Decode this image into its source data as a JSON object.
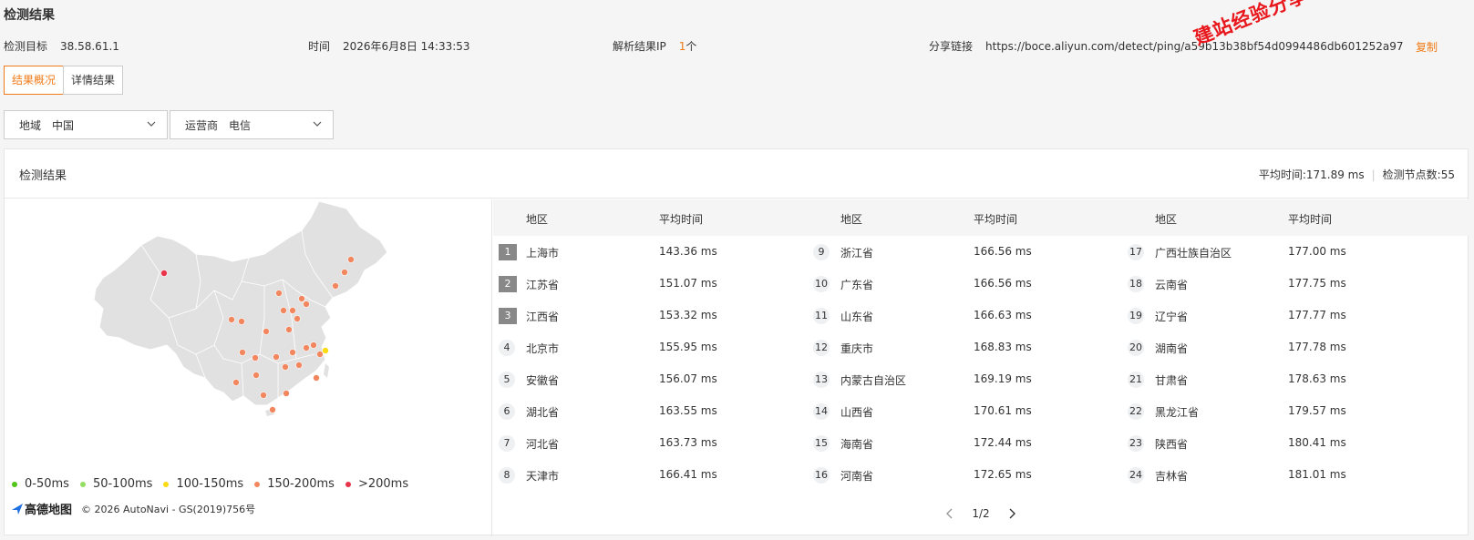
{
  "page_title": "检测结果",
  "meta": {
    "target_label": "检测目标",
    "target_value": "38.58.61.1",
    "time_label": "时间",
    "time_value": "2026年6月8日 14:33:53",
    "ip_label": "解析结果IP",
    "ip_count": "1",
    "ip_unit": "个",
    "share_label": "分享链接",
    "share_url": "https://boce.aliyun.com/detect/ping/a59b13b38bf54d0994486db601252a97",
    "copy_label": "复制"
  },
  "watermark": "建站经验分享-www.w",
  "tabs": [
    {
      "label": "结果概况",
      "active": true
    },
    {
      "label": "详情结果",
      "active": false
    }
  ],
  "filters": {
    "region_label": "地域",
    "region_value": "中国",
    "isp_label": "运营商",
    "isp_value": "电信"
  },
  "panel": {
    "title": "检测结果",
    "avg_label": "平均时间:171.89 ms",
    "nodes_label": "检测节点数:55"
  },
  "legend": [
    {
      "label": "0-50ms",
      "color": "#52c41a"
    },
    {
      "label": "50-100ms",
      "color": "#95de64"
    },
    {
      "label": "100-150ms",
      "color": "#fadb14"
    },
    {
      "label": "150-200ms",
      "color": "#f2865e"
    },
    {
      "label": ">200ms",
      "color": "#e8334a"
    }
  ],
  "copyright": {
    "logo_text": "高德地图",
    "text": "© 2026 AutoNavi - GS(2019)756号"
  },
  "table": {
    "headers": {
      "region": "地区",
      "avg": "平均时间"
    },
    "columns": [
      [
        {
          "rank": "1",
          "region": "上海市",
          "avg": "143.36 ms"
        },
        {
          "rank": "2",
          "region": "江苏省",
          "avg": "151.07 ms"
        },
        {
          "rank": "3",
          "region": "江西省",
          "avg": "153.32 ms"
        },
        {
          "rank": "4",
          "region": "北京市",
          "avg": "155.95 ms"
        },
        {
          "rank": "5",
          "region": "安徽省",
          "avg": "156.07 ms"
        },
        {
          "rank": "6",
          "region": "湖北省",
          "avg": "163.55 ms"
        },
        {
          "rank": "7",
          "region": "河北省",
          "avg": "163.73 ms"
        },
        {
          "rank": "8",
          "region": "天津市",
          "avg": "166.41 ms"
        }
      ],
      [
        {
          "rank": "9",
          "region": "浙江省",
          "avg": "166.56 ms"
        },
        {
          "rank": "10",
          "region": "广东省",
          "avg": "166.56 ms"
        },
        {
          "rank": "11",
          "region": "山东省",
          "avg": "166.63 ms"
        },
        {
          "rank": "12",
          "region": "重庆市",
          "avg": "168.83 ms"
        },
        {
          "rank": "13",
          "region": "内蒙古自治区",
          "avg": "169.19 ms"
        },
        {
          "rank": "14",
          "region": "山西省",
          "avg": "170.61 ms"
        },
        {
          "rank": "15",
          "region": "海南省",
          "avg": "172.44 ms"
        },
        {
          "rank": "16",
          "region": "河南省",
          "avg": "172.65 ms"
        }
      ],
      [
        {
          "rank": "17",
          "region": "广西壮族自治区",
          "avg": "177.00 ms"
        },
        {
          "rank": "18",
          "region": "云南省",
          "avg": "177.75 ms"
        },
        {
          "rank": "19",
          "region": "辽宁省",
          "avg": "177.77 ms"
        },
        {
          "rank": "20",
          "region": "湖南省",
          "avg": "177.78 ms"
        },
        {
          "rank": "21",
          "region": "甘肃省",
          "avg": "178.63 ms"
        },
        {
          "rank": "22",
          "region": "黑龙江省",
          "avg": "179.57 ms"
        },
        {
          "rank": "23",
          "region": "陕西省",
          "avg": "180.41 ms"
        },
        {
          "rank": "24",
          "region": "吉林省",
          "avg": "181.01 ms"
        }
      ]
    ]
  },
  "pager": {
    "text": "1/2"
  }
}
